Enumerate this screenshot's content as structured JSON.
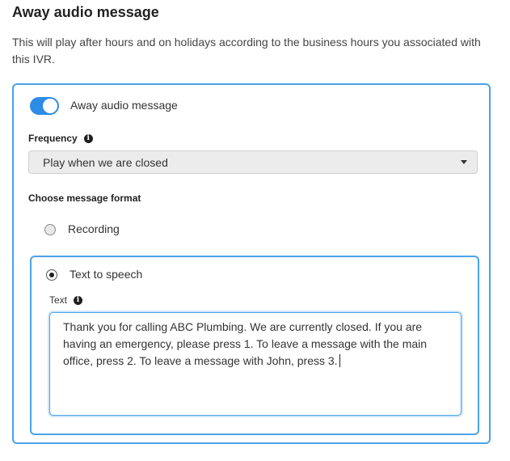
{
  "section": {
    "title": "Away audio message",
    "description": "This will play after hours and on holidays according to the business hours you associated with this IVR."
  },
  "toggle": {
    "label": "Away audio message",
    "enabled": true,
    "accent_color": "#2d8ce6"
  },
  "frequency": {
    "label": "Frequency",
    "info_icon": "info-icon",
    "selected_value": "Play when we are closed"
  },
  "message_format": {
    "label": "Choose message format",
    "options": [
      {
        "label": "Recording",
        "selected": false
      },
      {
        "label": "Text to speech",
        "selected": true
      }
    ]
  },
  "tts": {
    "text_label": "Text",
    "info_icon": "info-icon",
    "text_value": "Thank you for calling ABC Plumbing. We are currently closed. If you are having an emergency, please press 1.  To leave a message with the main office, press 2. To leave a message with John, press 3."
  },
  "colors": {
    "accent": "#2d8ce6",
    "card_border": "#4aa3e8"
  }
}
